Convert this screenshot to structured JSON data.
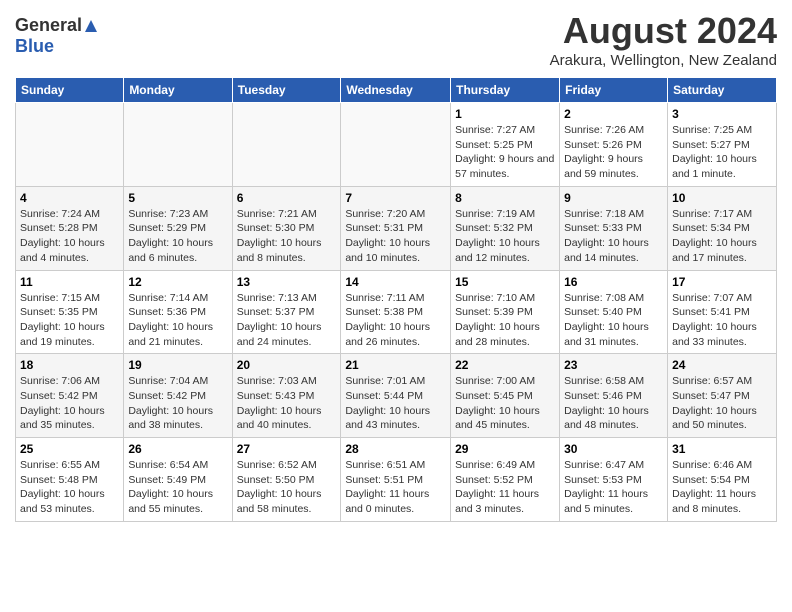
{
  "header": {
    "logo_general": "General",
    "logo_blue": "Blue",
    "title": "August 2024",
    "location": "Arakura, Wellington, New Zealand"
  },
  "calendar": {
    "headers": [
      "Sunday",
      "Monday",
      "Tuesday",
      "Wednesday",
      "Thursday",
      "Friday",
      "Saturday"
    ],
    "weeks": [
      [
        {
          "day": "",
          "info": ""
        },
        {
          "day": "",
          "info": ""
        },
        {
          "day": "",
          "info": ""
        },
        {
          "day": "",
          "info": ""
        },
        {
          "day": "1",
          "info": "Sunrise: 7:27 AM\nSunset: 5:25 PM\nDaylight: 9 hours and 57 minutes."
        },
        {
          "day": "2",
          "info": "Sunrise: 7:26 AM\nSunset: 5:26 PM\nDaylight: 9 hours and 59 minutes."
        },
        {
          "day": "3",
          "info": "Sunrise: 7:25 AM\nSunset: 5:27 PM\nDaylight: 10 hours and 1 minute."
        }
      ],
      [
        {
          "day": "4",
          "info": "Sunrise: 7:24 AM\nSunset: 5:28 PM\nDaylight: 10 hours and 4 minutes."
        },
        {
          "day": "5",
          "info": "Sunrise: 7:23 AM\nSunset: 5:29 PM\nDaylight: 10 hours and 6 minutes."
        },
        {
          "day": "6",
          "info": "Sunrise: 7:21 AM\nSunset: 5:30 PM\nDaylight: 10 hours and 8 minutes."
        },
        {
          "day": "7",
          "info": "Sunrise: 7:20 AM\nSunset: 5:31 PM\nDaylight: 10 hours and 10 minutes."
        },
        {
          "day": "8",
          "info": "Sunrise: 7:19 AM\nSunset: 5:32 PM\nDaylight: 10 hours and 12 minutes."
        },
        {
          "day": "9",
          "info": "Sunrise: 7:18 AM\nSunset: 5:33 PM\nDaylight: 10 hours and 14 minutes."
        },
        {
          "day": "10",
          "info": "Sunrise: 7:17 AM\nSunset: 5:34 PM\nDaylight: 10 hours and 17 minutes."
        }
      ],
      [
        {
          "day": "11",
          "info": "Sunrise: 7:15 AM\nSunset: 5:35 PM\nDaylight: 10 hours and 19 minutes."
        },
        {
          "day": "12",
          "info": "Sunrise: 7:14 AM\nSunset: 5:36 PM\nDaylight: 10 hours and 21 minutes."
        },
        {
          "day": "13",
          "info": "Sunrise: 7:13 AM\nSunset: 5:37 PM\nDaylight: 10 hours and 24 minutes."
        },
        {
          "day": "14",
          "info": "Sunrise: 7:11 AM\nSunset: 5:38 PM\nDaylight: 10 hours and 26 minutes."
        },
        {
          "day": "15",
          "info": "Sunrise: 7:10 AM\nSunset: 5:39 PM\nDaylight: 10 hours and 28 minutes."
        },
        {
          "day": "16",
          "info": "Sunrise: 7:08 AM\nSunset: 5:40 PM\nDaylight: 10 hours and 31 minutes."
        },
        {
          "day": "17",
          "info": "Sunrise: 7:07 AM\nSunset: 5:41 PM\nDaylight: 10 hours and 33 minutes."
        }
      ],
      [
        {
          "day": "18",
          "info": "Sunrise: 7:06 AM\nSunset: 5:42 PM\nDaylight: 10 hours and 35 minutes."
        },
        {
          "day": "19",
          "info": "Sunrise: 7:04 AM\nSunset: 5:42 PM\nDaylight: 10 hours and 38 minutes."
        },
        {
          "day": "20",
          "info": "Sunrise: 7:03 AM\nSunset: 5:43 PM\nDaylight: 10 hours and 40 minutes."
        },
        {
          "day": "21",
          "info": "Sunrise: 7:01 AM\nSunset: 5:44 PM\nDaylight: 10 hours and 43 minutes."
        },
        {
          "day": "22",
          "info": "Sunrise: 7:00 AM\nSunset: 5:45 PM\nDaylight: 10 hours and 45 minutes."
        },
        {
          "day": "23",
          "info": "Sunrise: 6:58 AM\nSunset: 5:46 PM\nDaylight: 10 hours and 48 minutes."
        },
        {
          "day": "24",
          "info": "Sunrise: 6:57 AM\nSunset: 5:47 PM\nDaylight: 10 hours and 50 minutes."
        }
      ],
      [
        {
          "day": "25",
          "info": "Sunrise: 6:55 AM\nSunset: 5:48 PM\nDaylight: 10 hours and 53 minutes."
        },
        {
          "day": "26",
          "info": "Sunrise: 6:54 AM\nSunset: 5:49 PM\nDaylight: 10 hours and 55 minutes."
        },
        {
          "day": "27",
          "info": "Sunrise: 6:52 AM\nSunset: 5:50 PM\nDaylight: 10 hours and 58 minutes."
        },
        {
          "day": "28",
          "info": "Sunrise: 6:51 AM\nSunset: 5:51 PM\nDaylight: 11 hours and 0 minutes."
        },
        {
          "day": "29",
          "info": "Sunrise: 6:49 AM\nSunset: 5:52 PM\nDaylight: 11 hours and 3 minutes."
        },
        {
          "day": "30",
          "info": "Sunrise: 6:47 AM\nSunset: 5:53 PM\nDaylight: 11 hours and 5 minutes."
        },
        {
          "day": "31",
          "info": "Sunrise: 6:46 AM\nSunset: 5:54 PM\nDaylight: 11 hours and 8 minutes."
        }
      ]
    ]
  }
}
